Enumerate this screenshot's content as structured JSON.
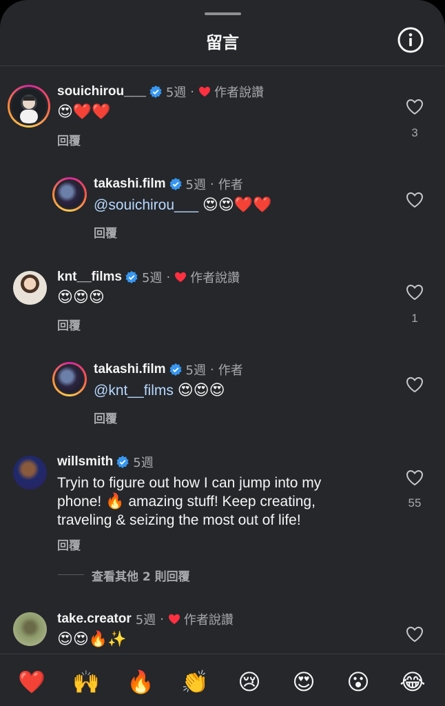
{
  "header": {
    "title": "留言",
    "info_icon": "info-circle-icon"
  },
  "colors": {
    "background": "#25272b",
    "mention": "#b8d8ff",
    "verified": "#3897f0",
    "heart_red": "#ff3040",
    "secondary_text": "#a8a9ad"
  },
  "comments": [
    {
      "username": "souichirou___",
      "verified": true,
      "time": "5週",
      "liked_by_author": true,
      "author_tag": "作者說讚",
      "emojis": "😍❤️❤️",
      "reply_label": "回覆",
      "like_count": "3"
    },
    {
      "username": "takashi.film",
      "verified": true,
      "time": "5週",
      "author_tag": "作者",
      "mention": "@souichirou___",
      "emojis": "😍😍❤️❤️",
      "reply_label": "回覆",
      "like_count": ""
    },
    {
      "username": "knt__films",
      "verified": true,
      "time": "5週",
      "liked_by_author": true,
      "author_tag": "作者說讚",
      "emojis": "😍😍😍",
      "reply_label": "回覆",
      "like_count": "1"
    },
    {
      "username": "takashi.film",
      "verified": true,
      "time": "5週",
      "author_tag": "作者",
      "mention": "@knt__films",
      "emojis": "😍😍😍",
      "reply_label": "回覆",
      "like_count": ""
    },
    {
      "username": "willsmith",
      "verified": true,
      "time": "5週",
      "text_line1": "Tryin to figure out how I can jump into my",
      "text_line2a": "phone! ",
      "text_line2_emoji": "🔥",
      "text_line2b": " amazing stuff! Keep creating,",
      "text_line3": "traveling & seizing the most out of life!",
      "reply_label": "回覆",
      "like_count": "55",
      "more_replies": "查看其他 2 則回覆"
    },
    {
      "username": "take.creator",
      "verified": false,
      "time": "5週",
      "liked_by_author": true,
      "author_tag": "作者說讚",
      "emojis": "😍😍🔥✨",
      "like_count": ""
    }
  ],
  "quick_reactions": [
    "❤️",
    "🙌",
    "🔥",
    "👏",
    "😢",
    "😍",
    "😮",
    "😂"
  ]
}
